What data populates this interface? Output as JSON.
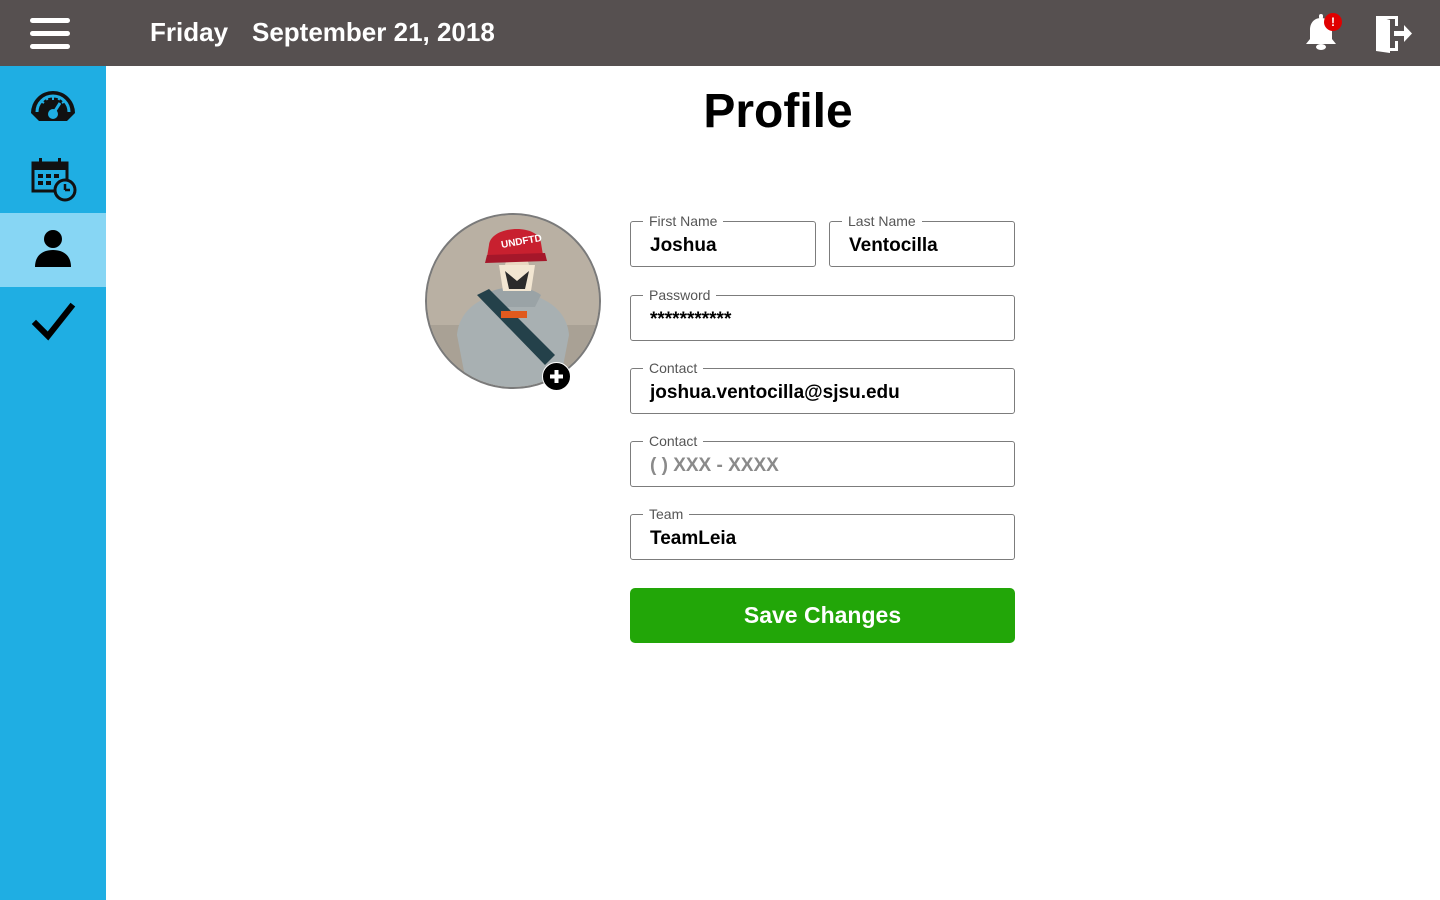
{
  "header": {
    "day": "Friday",
    "date": "September 21, 2018",
    "notification_badge": "!",
    "menu_icon": "hamburger-menu-icon",
    "notification_icon": "bell-icon",
    "logout_icon": "logout-door-icon",
    "background_color": "#565050",
    "badge_color": "#e00000"
  },
  "sidebar": {
    "background_color": "#1faee3",
    "active_color": "#87d6f4",
    "items": [
      {
        "icon": "speedometer-icon",
        "active": false
      },
      {
        "icon": "calendar-clock-icon",
        "active": false
      },
      {
        "icon": "user-icon",
        "active": true
      },
      {
        "icon": "checkmark-icon",
        "active": false
      }
    ]
  },
  "page": {
    "title": "Profile"
  },
  "profile": {
    "avatar_icon": "profile-photo",
    "add_photo_icon": "plus-circle-icon",
    "fields": {
      "first_name": {
        "label": "First Name",
        "value": "Joshua"
      },
      "last_name": {
        "label": "Last Name",
        "value": "Ventocilla"
      },
      "password": {
        "label": "Password",
        "value": "***********"
      },
      "email": {
        "label": "Contact",
        "value": "joshua.ventocilla@sjsu.edu"
      },
      "phone": {
        "label": "Contact",
        "placeholder": "( ) XXX - XXXX"
      },
      "team": {
        "label": "Team",
        "value": "TeamLeia"
      }
    },
    "save_label": "Save Changes",
    "save_color": "#22a608"
  }
}
